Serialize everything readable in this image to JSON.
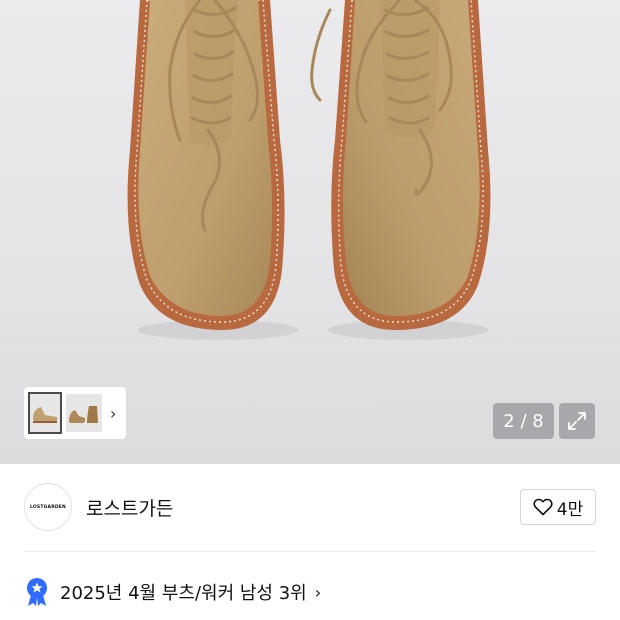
{
  "gallery": {
    "current_page": 2,
    "total_pages": 8,
    "counter_text": "2 / 8",
    "thumbnails": [
      {
        "name": "thumbnail-boots-pair",
        "selected": true
      },
      {
        "name": "thumbnail-boots-side",
        "selected": false
      }
    ]
  },
  "brand": {
    "logo_text": "LOSTGARDEN",
    "name": "로스트가든",
    "likes_label": "4만"
  },
  "ranking": {
    "text": "2025년 4월 부츠/워커 남성 3위"
  },
  "colors": {
    "accent_blue": "#2f6bff",
    "suede": "#c3a272",
    "sole": "#b86a45"
  },
  "icons": [
    "heart-icon",
    "expand-icon",
    "chevron-right-icon",
    "award-badge-icon"
  ]
}
